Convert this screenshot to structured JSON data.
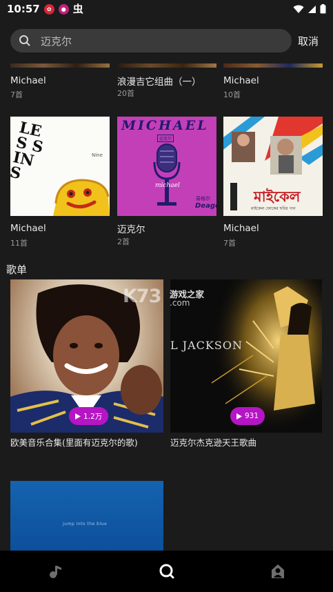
{
  "status_bar": {
    "time": "10:57"
  },
  "search": {
    "query": "迈克尔",
    "cancel_label": "取消"
  },
  "albums": [
    {
      "title": "Michael",
      "count": "7首"
    },
    {
      "title": "浪漫吉它组曲（一）",
      "count": "20首"
    },
    {
      "title": "Michael",
      "count": "10首"
    },
    {
      "title": "Michael",
      "count": "11首",
      "cover_text": "LES SINS",
      "cover_small": "Nine"
    },
    {
      "title": "迈克尔",
      "count": "2首",
      "cover_text": "MICHAEL",
      "cover_sub": "迈克尔",
      "cover_mid": "michael",
      "cover_side": "易格尔",
      "cover_brand": "Deage"
    },
    {
      "title": "Michael",
      "count": "7首",
      "cover_text": "মাইকেল",
      "cover_small": "মাইকেল ফোকের ছবির গান"
    }
  ],
  "playlists_section_title": "歌单",
  "playlists": [
    {
      "title": "欧美音乐合集(里面有迈克尔的歌)",
      "plays": "1.2万"
    },
    {
      "title": "迈克尔杰克逊天王歌曲",
      "plays": "931",
      "cover_text": "L JACKSON"
    },
    {
      "title": "",
      "plays": "",
      "cover_text": "jump into the blue"
    }
  ],
  "watermark": {
    "brand": "K73",
    "text": "游戏之家",
    "domain": ".com"
  },
  "bottom_nav": [
    {
      "icon": "music-note-icon"
    },
    {
      "icon": "search-icon"
    },
    {
      "icon": "profile-icon"
    }
  ]
}
